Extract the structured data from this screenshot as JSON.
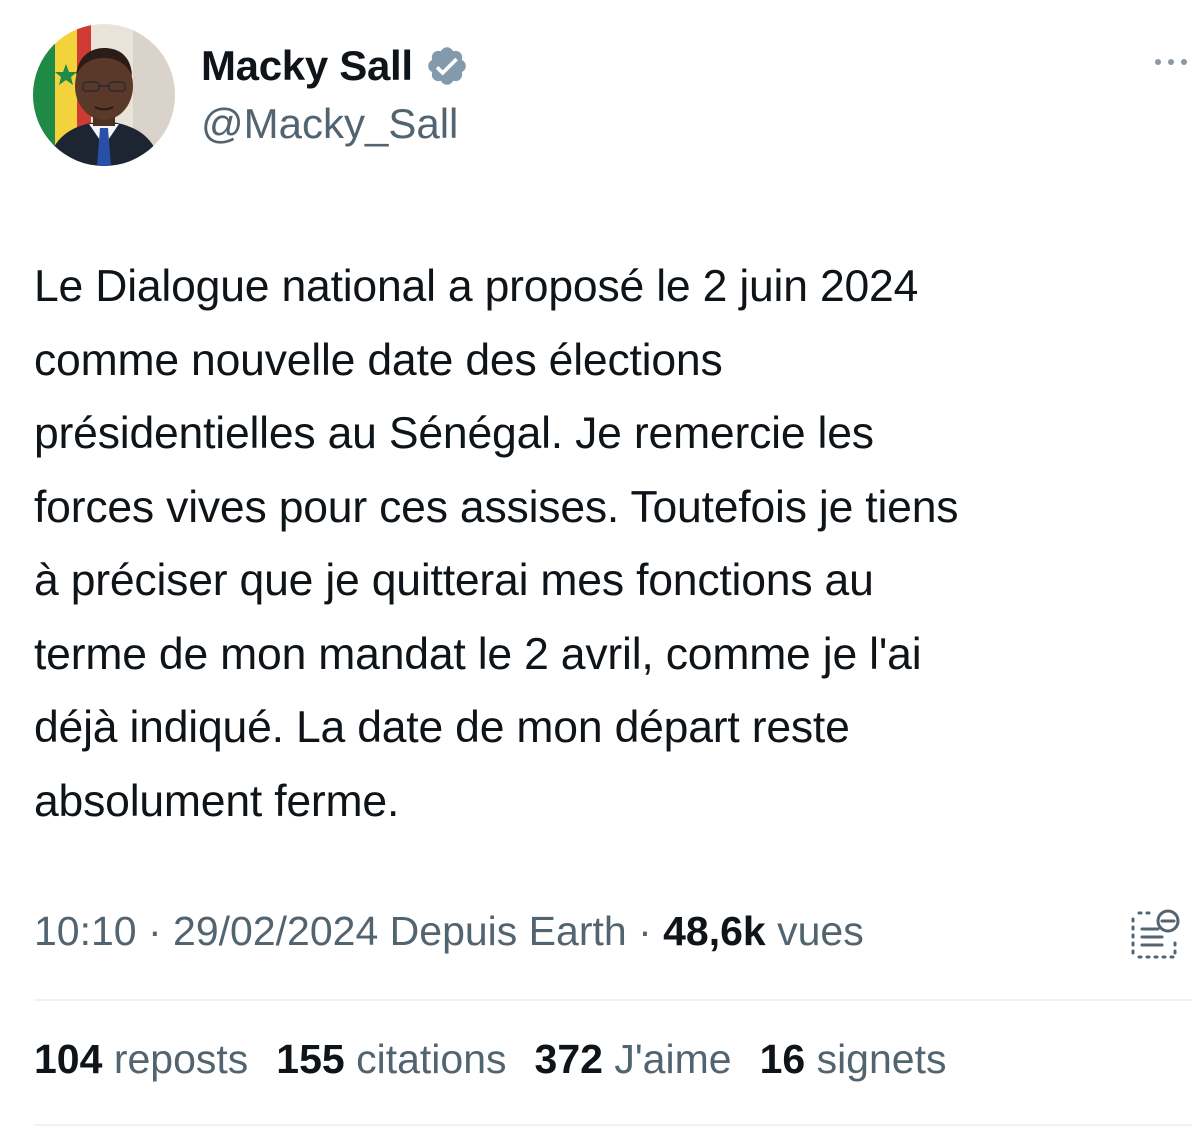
{
  "author": {
    "display_name": "Macky Sall",
    "handle": "@Macky_Sall",
    "verified_icon": "verified-badge-icon",
    "verified_color": "#829aab"
  },
  "tweet": {
    "text": "Le Dialogue national a proposé le 2 juin 2024\ncomme nouvelle date des élections\nprésidentielles au Sénégal. Je remercie les\nforces vives pour ces assises.  Toutefois je tiens\nà préciser que je quitterai mes fonctions au\nterme de mon mandat le 2 avril, comme je l'ai\ndéjà indiqué. La date de mon départ reste\nabsolument ferme."
  },
  "meta": {
    "time": "10:10",
    "separator_1": " · ",
    "date": "29/02/2024",
    "source": "Depuis Earth",
    "separator_2": " · ",
    "views_count": "48,6k",
    "views_label": "vues"
  },
  "stats": {
    "reposts_count": "104",
    "reposts_label": "reposts",
    "quotes_count": "155",
    "quotes_label": "citations",
    "likes_count": "372",
    "likes_label": "J'aime",
    "bookmarks_count": "16",
    "bookmarks_label": "signets"
  },
  "colors": {
    "text_primary": "#0f1419",
    "text_secondary": "#536471",
    "divider": "#eff3f4"
  }
}
